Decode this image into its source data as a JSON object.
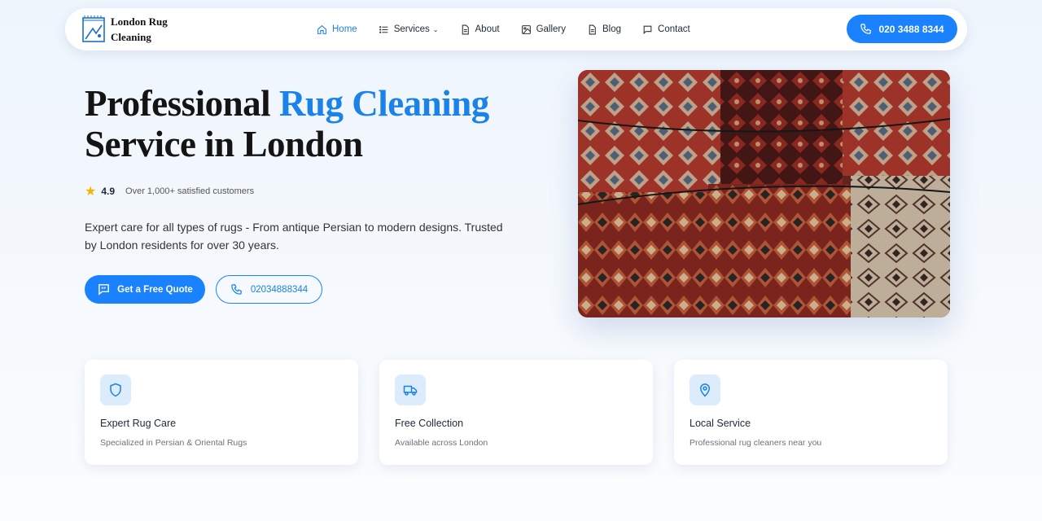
{
  "brand": {
    "name_line1": "London Rug",
    "name_line2": "Cleaning"
  },
  "nav": {
    "items": [
      {
        "label": "Home",
        "icon": "home-icon",
        "active": true
      },
      {
        "label": "Services",
        "icon": "list-icon",
        "has_dropdown": true
      },
      {
        "label": "About",
        "icon": "document-icon"
      },
      {
        "label": "Gallery",
        "icon": "image-icon"
      },
      {
        "label": "Blog",
        "icon": "document-icon"
      },
      {
        "label": "Contact",
        "icon": "chat-icon"
      }
    ],
    "phone_label": "020 3488 8344"
  },
  "hero": {
    "title_part1": "Professional ",
    "title_highlight": "Rug Cleaning",
    "title_part2": "Service in London",
    "rating_value": "4.9",
    "rating_text": "Over 1,000+ satisfied customers",
    "description": "Expert care for all types of rugs - From antique Persian to modern designs. Trusted by London residents for over 30 years.",
    "primary_cta": "Get a Free Quote",
    "phone_cta": "02034888344"
  },
  "features": [
    {
      "title": "Expert Rug Care",
      "subtitle": "Specialized in Persian & Oriental Rugs",
      "icon": "shield-icon"
    },
    {
      "title": "Free Collection",
      "subtitle": "Available across London",
      "icon": "truck-icon"
    },
    {
      "title": "Local Service",
      "subtitle": "Professional rug cleaners near you",
      "icon": "map-pin-icon"
    }
  ],
  "colors": {
    "accent": "#1a82ff",
    "accent_text": "#1a82e8",
    "icon_bg": "#dcecfb",
    "star": "#f5b400"
  }
}
